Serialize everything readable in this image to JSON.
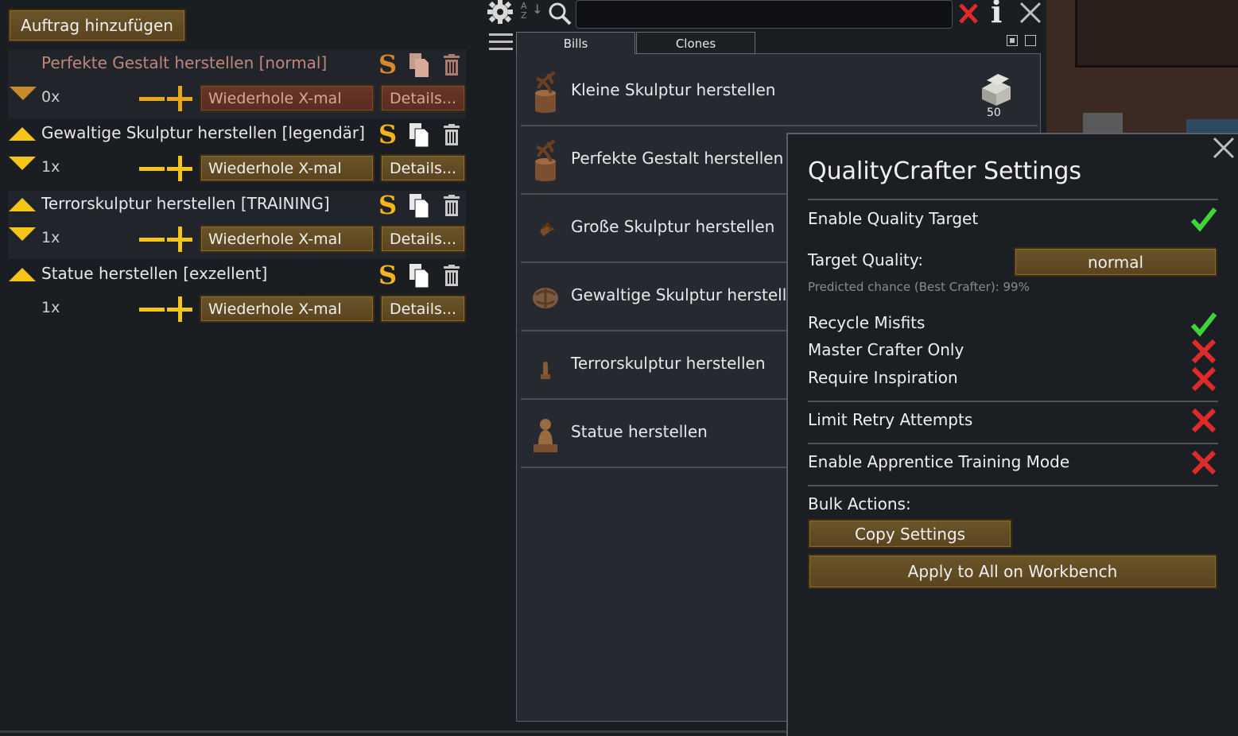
{
  "bills_panel": {
    "add_bill_label": "Auftrag hinzufügen",
    "bills": [
      {
        "title": "Perfekte Gestalt herstellen [normal]",
        "count": "0x",
        "repeat_label": "Wiederhole X-mal",
        "details_label": "Details...",
        "state": "suspended"
      },
      {
        "title": "Gewaltige Skulptur herstellen [legendär]",
        "count": "1x",
        "repeat_label": "Wiederhole X-mal",
        "details_label": "Details...",
        "state": "active"
      },
      {
        "title": "Terrorskulptur herstellen [TRAINING]",
        "count": "1x",
        "repeat_label": "Wiederhole X-mal",
        "details_label": "Details...",
        "state": "active"
      },
      {
        "title": "Statue herstellen [exzellent]",
        "count": "1x",
        "repeat_label": "Wiederhole X-mal",
        "details_label": "Details...",
        "state": "active"
      }
    ],
    "s_label": "S"
  },
  "recipes_panel": {
    "tabs": [
      "Bills",
      "Clones"
    ],
    "active_tab": 0,
    "recipes": [
      {
        "label": "Kleine Skulptur herstellen",
        "cost": "50"
      },
      {
        "label": "Perfekte Gestalt herstellen"
      },
      {
        "label": "Große Skulptur herstellen"
      },
      {
        "label": "Gewaltige Skulptur herstelle"
      },
      {
        "label": "Terrorskulptur herstellen"
      },
      {
        "label": "Statue herstellen"
      }
    ],
    "sort_label_a": "A",
    "sort_label_z": "Z"
  },
  "qc_settings": {
    "title": "QualityCrafter Settings",
    "enable_quality_target": {
      "label": "Enable Quality Target",
      "value": true
    },
    "target_quality": {
      "label": "Target Quality:",
      "value": "normal"
    },
    "predicted": "Predicted chance (Best Crafter): 99%",
    "recycle_misfits": {
      "label": "Recycle Misfits",
      "value": true
    },
    "master_crafter_only": {
      "label": "Master Crafter Only",
      "value": false
    },
    "require_inspiration": {
      "label": "Require Inspiration",
      "value": false
    },
    "limit_retry": {
      "label": "Limit Retry Attempts",
      "value": false
    },
    "apprentice_mode": {
      "label": "Enable Apprentice Training Mode",
      "value": false
    },
    "bulk_actions_label": "Bulk Actions:",
    "copy_settings_label": "Copy Settings",
    "apply_all_label": "Apply to All on Workbench"
  },
  "colors": {
    "accent_yellow": "#f5c518",
    "check_green": "#3fd43a",
    "cross_red": "#e02a2a",
    "button_brown": "#5a4420"
  }
}
